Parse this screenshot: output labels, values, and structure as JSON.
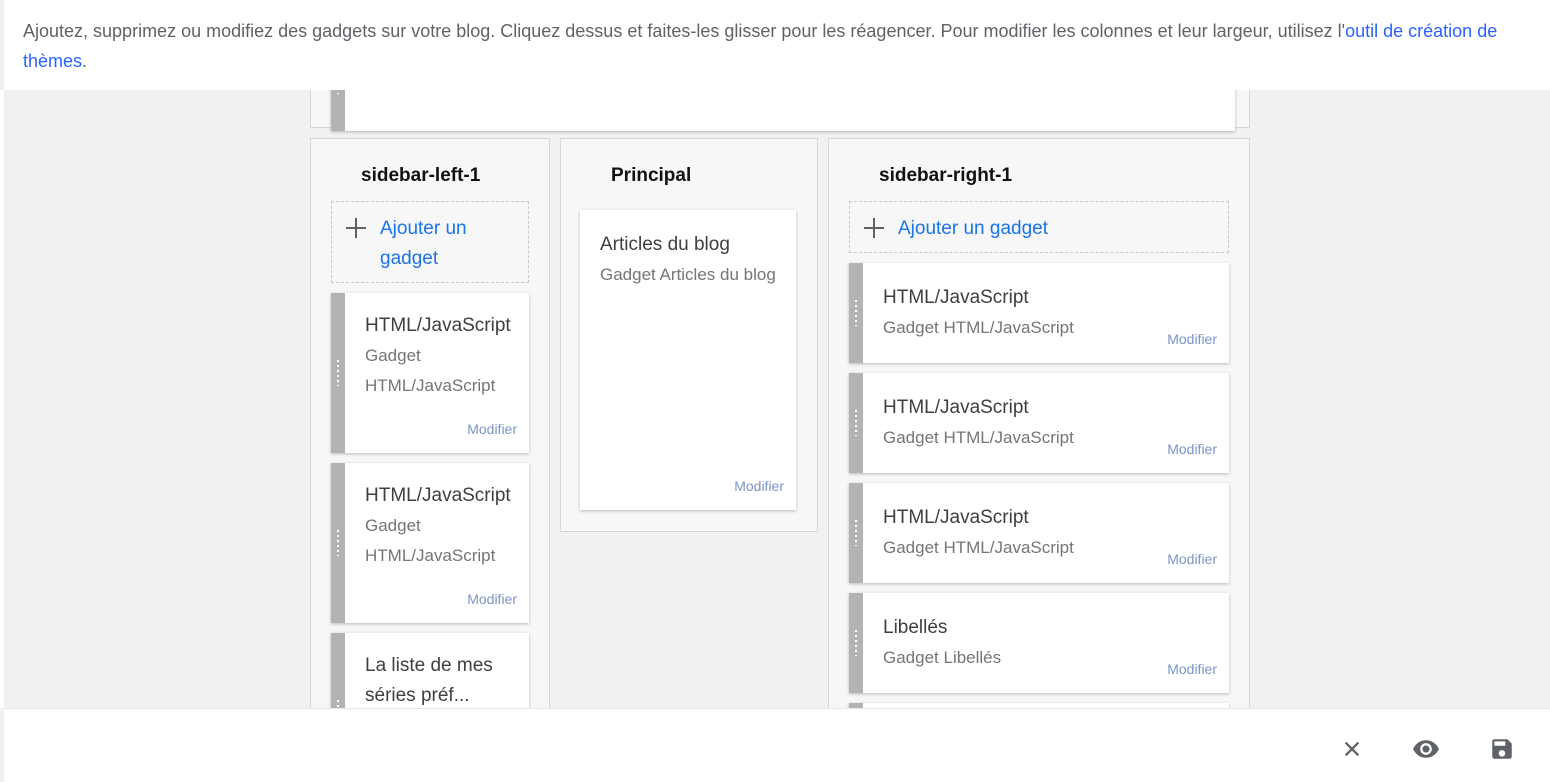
{
  "intro": {
    "text": "Ajoutez, supprimez ou modifiez des gadgets sur votre blog. Cliquez dessus et faites-les glisser pour les réagencer. Pour modifier les colonnes et leur largeur, utilisez l'",
    "link": "outil de création de thèmes",
    "end": "."
  },
  "columns": {
    "left": {
      "title": "sidebar-left-1",
      "add_label": "Ajouter un gadget",
      "gadgets": [
        {
          "title": "HTML/JavaScript",
          "subtitle": "Gadget HTML/JavaScript",
          "modify": "Modifier"
        },
        {
          "title": "HTML/JavaScript",
          "subtitle": "Gadget HTML/JavaScript",
          "modify": "Modifier"
        },
        {
          "title": "La liste de mes séries préf...",
          "subtitle": "",
          "modify": ""
        }
      ]
    },
    "main": {
      "title": "Principal",
      "gadgets": [
        {
          "title": "Articles du blog",
          "subtitle": "Gadget Articles du blog",
          "modify": "Modifier"
        }
      ]
    },
    "right": {
      "title": "sidebar-right-1",
      "add_label": "Ajouter un gadget",
      "gadgets": [
        {
          "title": "HTML/JavaScript",
          "subtitle": "Gadget HTML/JavaScript",
          "modify": "Modifier"
        },
        {
          "title": "HTML/JavaScript",
          "subtitle": "Gadget HTML/JavaScript",
          "modify": "Modifier"
        },
        {
          "title": "HTML/JavaScript",
          "subtitle": "Gadget HTML/JavaScript",
          "modify": "Modifier"
        },
        {
          "title": "Libellés",
          "subtitle": "Gadget Libellés",
          "modify": "Modifier"
        }
      ]
    }
  },
  "footer": {
    "close_icon": "close-icon",
    "preview_icon": "eye-icon",
    "save_icon": "save-icon"
  },
  "colors": {
    "link": "#1a73e8",
    "modify": "#7a95c9",
    "grip": "#b3b3b3",
    "canvas": "#f1f1f1"
  }
}
